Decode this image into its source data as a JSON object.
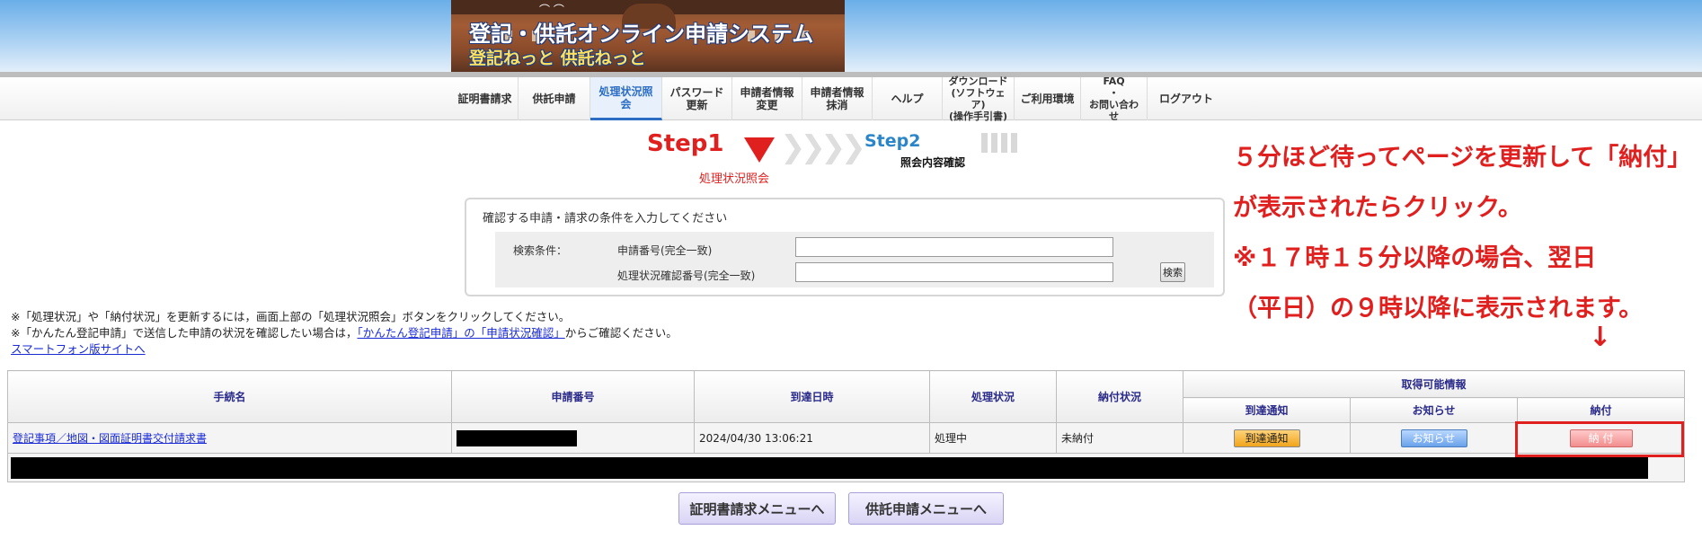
{
  "header": {
    "title": "登記・供託オンライン申請システム",
    "subtitle": "登記ねっと 供託ねっと"
  },
  "nav": {
    "items": [
      {
        "label": "証明書請求"
      },
      {
        "label": "供託申請"
      },
      {
        "label": "処理状況照会",
        "active": true
      },
      {
        "label": "パスワード\n更新"
      },
      {
        "label": "申請者情報\n変更"
      },
      {
        "label": "申請者情報\n抹消"
      },
      {
        "label": "ヘルプ"
      },
      {
        "label": "ダウンロード\n(ソフトウェア)\n(操作手引書)"
      },
      {
        "label": "ご利用環境"
      },
      {
        "label": "FAQ\n・\nお問い合わせ"
      },
      {
        "label": "ログアウト"
      }
    ]
  },
  "steps": {
    "step1": {
      "title": "Step1",
      "label": "処理状況照会"
    },
    "step2": {
      "title": "Step2",
      "label": "照会内容確認"
    }
  },
  "annotation": {
    "line1": "５分ほど待ってページを更新して「納付」",
    "line2": "が表示されたらクリック。",
    "line3": "※１７時１５分以降の場合、翌日",
    "line4": "（平日）の９時以降に表示されます。",
    "arrow": "↓",
    "color": "#e0201f"
  },
  "search": {
    "title": "確認する申請・請求の条件を入力してください",
    "condition_label": "検索条件：",
    "field1_label": "申請番号(完全一致)",
    "field1_value": "",
    "field2_label": "処理状況確認番号(完全一致)",
    "field2_value": "",
    "button": "検索"
  },
  "notes": {
    "line1": "※「処理状況」や「納付状況」を更新するには，画面上部の「処理状況照会」ボタンをクリックしてください。",
    "line2_prefix": "※「かんたん登記申請」で送信した申請の状況を確認したい場合は，",
    "line2_link": "「かんたん登記申請」の「申請状況確認」",
    "line2_suffix": "からご確認ください。",
    "smartphone_link": "スマートフォン版サイトへ"
  },
  "table": {
    "headers": {
      "procedure": "手続名",
      "application_no": "申請番号",
      "arrival": "到達日時",
      "status": "処理状況",
      "payment_status": "納付状況",
      "available": "取得可能情報",
      "arrival_notice": "到達通知",
      "notice": "お知らせ",
      "payment": "納付"
    },
    "row": {
      "procedure": "登記事項／地図・図面証明書交付請求書",
      "arrival": "2024/04/30 13:06:21",
      "status": "処理中",
      "payment_status": "未納付",
      "arrival_btn": "到達通知",
      "notice_btn": "お知らせ",
      "payment_btn": "納 付"
    }
  },
  "footer": {
    "cert_menu": "証明書請求メニューへ",
    "deposit_menu": "供託申請メニューへ"
  }
}
